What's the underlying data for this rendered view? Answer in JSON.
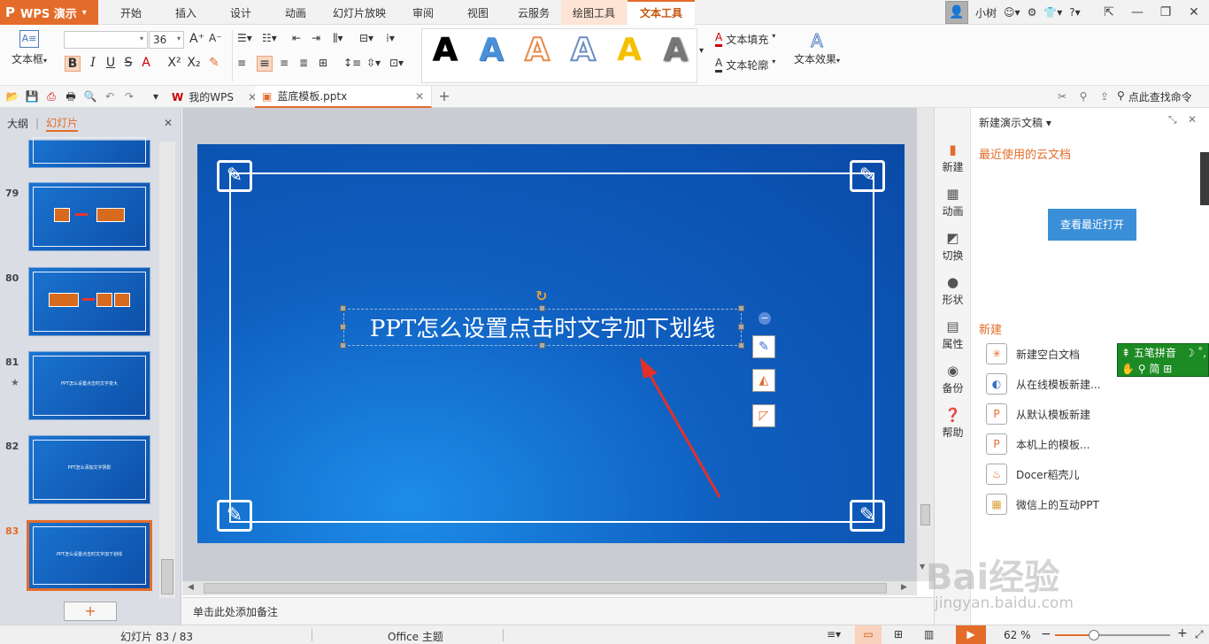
{
  "app": {
    "name": "WPS 演示",
    "logo_glyph": "P",
    "accent": "#e36c2b"
  },
  "menu_tabs": [
    {
      "label": "开始"
    },
    {
      "label": "插入"
    },
    {
      "label": "设计"
    },
    {
      "label": "动画"
    },
    {
      "label": "幻灯片放映"
    },
    {
      "label": "审阅"
    },
    {
      "label": "视图"
    },
    {
      "label": "云服务"
    },
    {
      "label": "绘图工具"
    },
    {
      "label": "文本工具"
    }
  ],
  "active_tab": "文本工具",
  "user": {
    "name": "小树"
  },
  "ribbon": {
    "textbox_label": "文本框",
    "font_name": "",
    "font_size": "36",
    "text_fill_label": "文本填充",
    "text_outline_label": "文本轮廓",
    "text_effect_label": "文本效果",
    "wordart_letter": "A",
    "wordart_colors": [
      "#000000",
      "#4a90d9",
      "#e8894a",
      "#ffffff",
      "#f5c000",
      "#666666"
    ]
  },
  "doc_tabs": [
    {
      "label": "我的WPS"
    },
    {
      "label": "蓝底模板.pptx"
    }
  ],
  "search_label": "点此查找命令",
  "left_pane": {
    "tab_outline": "大纲",
    "tab_slides": "幻灯片",
    "slides": [
      {
        "num": "79",
        "title": ""
      },
      {
        "num": "80",
        "title": ""
      },
      {
        "num": "81",
        "title": "PPT怎么设置点击时文字变大"
      },
      {
        "num": "82",
        "title": "PPT怎么添加文字阴影"
      },
      {
        "num": "83",
        "title": "PPT怎么设置点击时文字加下划线"
      }
    ],
    "add_button": "+"
  },
  "slide": {
    "title": "PPT怎么设置点击时文字加下划线"
  },
  "notes_placeholder": "单击此处添加备注",
  "task_pane": {
    "header": "新建演示文稿",
    "side_items": [
      {
        "label": "新建",
        "icon": "new-doc-icon"
      },
      {
        "label": "动画",
        "icon": "animation-icon"
      },
      {
        "label": "切换",
        "icon": "transition-icon"
      },
      {
        "label": "形状",
        "icon": "shape-icon"
      },
      {
        "label": "属性",
        "icon": "property-icon"
      },
      {
        "label": "备份",
        "icon": "backup-icon"
      },
      {
        "label": "帮助",
        "icon": "help-icon"
      }
    ],
    "recent_title": "最近使用的云文档",
    "recent_button": "查看最近打开",
    "new_title": "新建",
    "new_items": [
      {
        "label": "新建空白文档"
      },
      {
        "label": "从在线模板新建..."
      },
      {
        "label": "从默认模板新建"
      },
      {
        "label": "本机上的模板..."
      },
      {
        "label": "Docer稻壳儿"
      },
      {
        "label": "微信上的互动PPT"
      }
    ]
  },
  "ime": {
    "line1": "五笔拼音",
    "line2": "简"
  },
  "status": {
    "slide_info": "幻灯片 83 / 83",
    "theme": "Office 主题",
    "zoom": "62 %",
    "zoom_fraction": 0.34
  },
  "watermark": {
    "brand": "Bai经验",
    "url": "jingyan.baidu.com"
  }
}
